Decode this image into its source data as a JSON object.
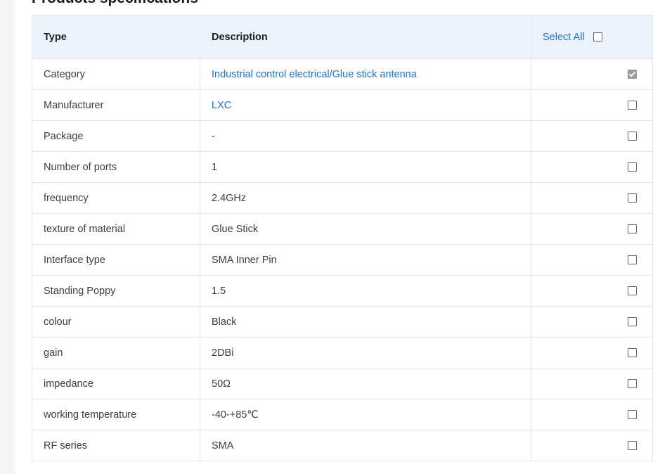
{
  "section": {
    "title": "Products specifications"
  },
  "table": {
    "headers": {
      "type": "Type",
      "description": "Description",
      "select_all": "Select All"
    },
    "rows": [
      {
        "type": "Category",
        "description": "Industrial control electrical/Glue stick antenna",
        "link": true,
        "checked": true
      },
      {
        "type": "Manufacturer",
        "description": "LXC",
        "link": true,
        "checked": false
      },
      {
        "type": "Package",
        "description": "-",
        "link": false,
        "checked": false
      },
      {
        "type": "Number of ports",
        "description": "1",
        "link": false,
        "checked": false
      },
      {
        "type": "frequency",
        "description": "2.4GHz",
        "link": false,
        "checked": false
      },
      {
        "type": "texture of material",
        "description": "Glue Stick",
        "link": false,
        "checked": false
      },
      {
        "type": "Interface type",
        "description": "SMA Inner Pin",
        "link": false,
        "checked": false
      },
      {
        "type": "Standing Poppy",
        "description": "1.5",
        "link": false,
        "checked": false
      },
      {
        "type": "colour",
        "description": "Black",
        "link": false,
        "checked": false
      },
      {
        "type": "gain",
        "description": "2DBi",
        "link": false,
        "checked": false
      },
      {
        "type": "impedance",
        "description": "50Ω",
        "link": false,
        "checked": false
      },
      {
        "type": "working temperature",
        "description": "-40-+85℃",
        "link": false,
        "checked": false
      },
      {
        "type": "RF series",
        "description": "SMA",
        "link": false,
        "checked": false
      }
    ]
  },
  "colors": {
    "link": "#1f6fd8",
    "header_bg": "#edf3fc",
    "border": "#e3e6ea"
  }
}
